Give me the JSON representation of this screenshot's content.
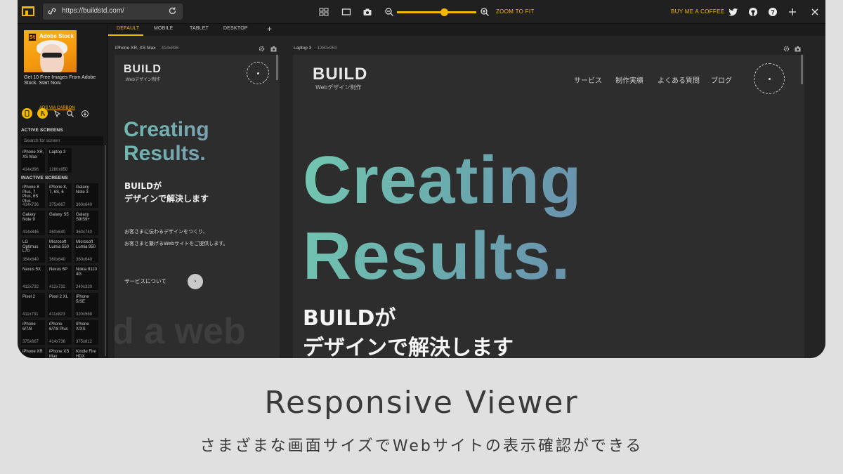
{
  "toolbar": {
    "url": "https://buildstd.com/",
    "zoom_label": "ZOOM TO FIT",
    "zoom_level": 0.6,
    "buy_coffee": "BUY ME A COFFEE",
    "accent_color": "#f5b800"
  },
  "sidebar": {
    "ad": {
      "brand": "Adobe Stock",
      "badge": "St",
      "text": "Get 10 Free Images From Adobe Stock. Start Now.",
      "via": "ADS VIA CARBON"
    },
    "active_title": "ACTIVE SCREENS",
    "search_placeholder": "Search for screen",
    "active_screens": [
      {
        "name": "iPhone XR, XS Max",
        "size": "414x896"
      },
      {
        "name": "Laptop 3",
        "size": "1280x950"
      }
    ],
    "inactive_title": "INACTIVE SCREENS",
    "inactive_screens": [
      {
        "name": "iPhone 8 Plus, 7 Plus, 6S Plus",
        "size": "414x736"
      },
      {
        "name": "iPhone 8, 7, 6S, 6",
        "size": "375x667"
      },
      {
        "name": "Galaxy Note 3",
        "size": "360x640"
      },
      {
        "name": "Galaxy Note 9",
        "size": "414x846"
      },
      {
        "name": "Galaxy S5",
        "size": "360x640"
      },
      {
        "name": "Galaxy S9/S9+",
        "size": "360x740"
      },
      {
        "name": "LG Optimus L70",
        "size": "384x640"
      },
      {
        "name": "Microsoft Lumia 550",
        "size": "360x640"
      },
      {
        "name": "Microsoft Lumia 950",
        "size": "360x640"
      },
      {
        "name": "Nexus 5X",
        "size": "412x732"
      },
      {
        "name": "Nexus 6P",
        "size": "412x732"
      },
      {
        "name": "Nokia 8110 4G",
        "size": "240x320"
      },
      {
        "name": "Pixel 2",
        "size": "411x731"
      },
      {
        "name": "Pixel 2 XL",
        "size": "411x823"
      },
      {
        "name": "iPhone 5/SE",
        "size": "320x568"
      },
      {
        "name": "iPhone 6/7/8",
        "size": "375x667"
      },
      {
        "name": "iPhone 6/7/8 Plus",
        "size": "414x736"
      },
      {
        "name": "iPhone X/XS",
        "size": "375x812"
      },
      {
        "name": "iPhone XR",
        "size": ""
      },
      {
        "name": "iPhone XS Max",
        "size": ""
      },
      {
        "name": "Kindle Fire HDX",
        "size": ""
      }
    ]
  },
  "tabs": [
    "DEFAULT",
    "MOBILE",
    "TABLET",
    "DESKTOP"
  ],
  "add_tab": "+",
  "mobile_preview": {
    "device_name": "iPhone XR, XS Max",
    "device_size": "414x896",
    "logo": "BUILD",
    "logo_sub": "Webデザイン制作",
    "title_line1": "Creating",
    "title_line2": "Results.",
    "sub_line1": "BUILDが",
    "sub_line2": "デザインで解決します",
    "body_line1": "お客さまに伝わるデザインをつくり、",
    "body_line2": "お客さまと繋げるWebサイトをご提供します。",
    "link_text": "サービスについて",
    "arrow": "›",
    "ghost_text": "d a web"
  },
  "laptop_preview": {
    "device_name": "Laptop 3",
    "device_size": "1280x950",
    "logo": "BUILD",
    "logo_sub": "Webデザイン制作",
    "nav": [
      "サービス",
      "制作実績",
      "よくある質問",
      "ブログ"
    ],
    "title_line1": "Creating",
    "title_line2": "Results.",
    "sub_line1": "BUILDが",
    "sub_line2": "デザインで解決します"
  },
  "caption": {
    "title": "Responsive Viewer",
    "subtitle": "さまざまな画面サイズでWebサイトの表示確認ができる"
  }
}
